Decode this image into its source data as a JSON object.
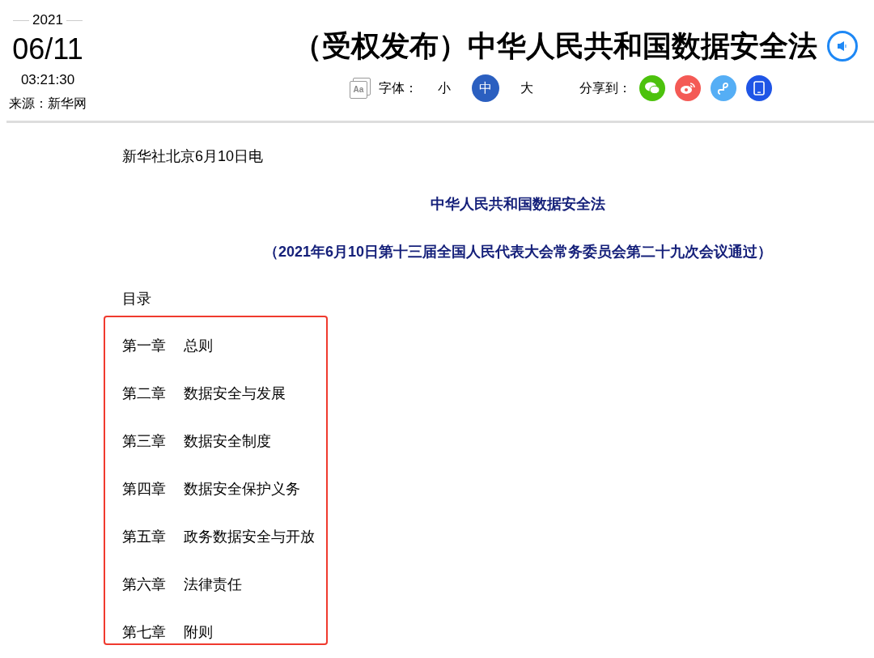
{
  "dateline": {
    "year": "2021",
    "date": "06/11",
    "time": "03:21:30",
    "source": "来源：新华网"
  },
  "title": "（受权发布）中华人民共和国数据安全法",
  "toolbar": {
    "font_icon_label": "Aa",
    "font_label": "字体：",
    "font_sizes": [
      {
        "label": "小",
        "selected": false
      },
      {
        "label": "中",
        "selected": true
      },
      {
        "label": "大",
        "selected": false
      }
    ],
    "share_label": "分享到：",
    "share": [
      {
        "kind": "wechat"
      },
      {
        "kind": "weibo"
      },
      {
        "kind": "link"
      },
      {
        "kind": "tablet"
      }
    ]
  },
  "article": {
    "dateline": "新华社北京6月10日电",
    "heading": "中华人民共和国数据安全法",
    "subheading": "（2021年6月10日第十三届全国人民代表大会常务委员会第二十九次会议通过）",
    "toc_label": "目录",
    "chapters": [
      {
        "number": "第一章",
        "title": "总则"
      },
      {
        "number": "第二章",
        "title": "数据安全与发展"
      },
      {
        "number": "第三章",
        "title": "数据安全制度"
      },
      {
        "number": "第四章",
        "title": "数据安全保护义务"
      },
      {
        "number": "第五章",
        "title": "政务数据安全与开放"
      },
      {
        "number": "第六章",
        "title": "法律责任"
      },
      {
        "number": "第七章",
        "title": "附则"
      }
    ],
    "highlighted": true
  }
}
